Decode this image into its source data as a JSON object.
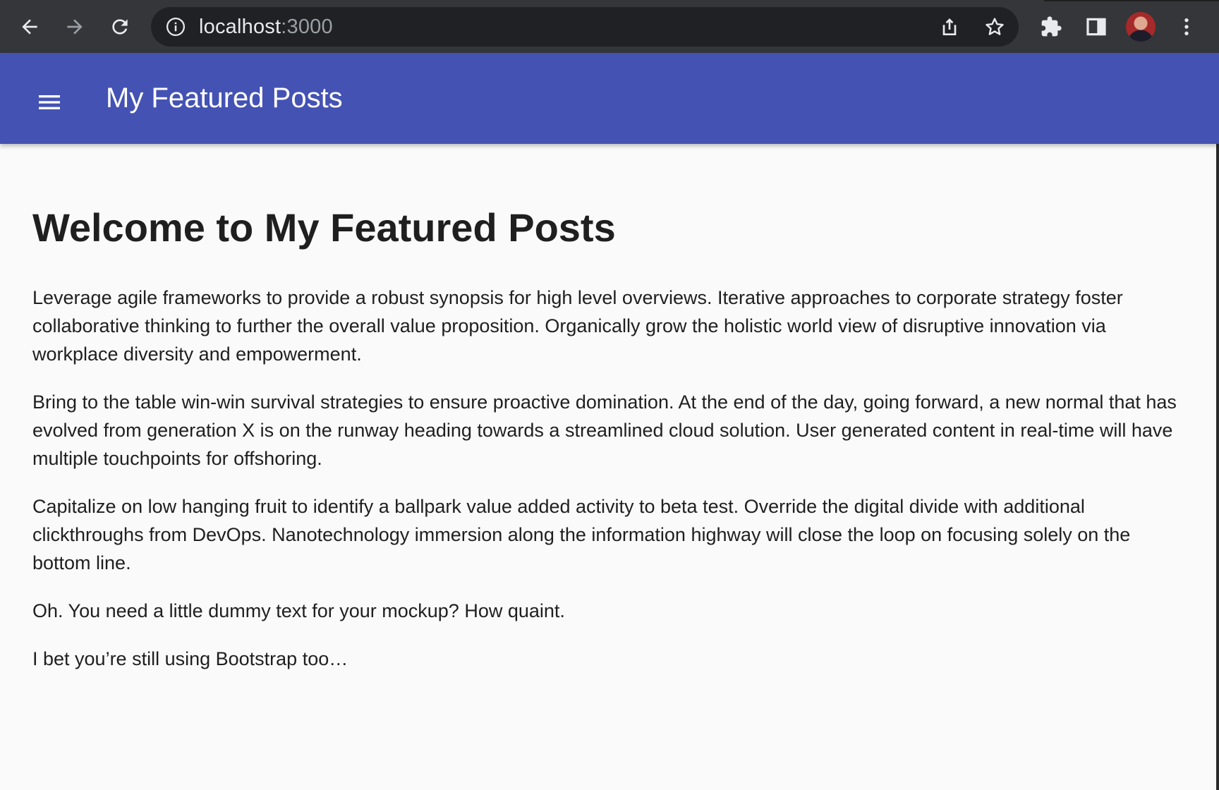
{
  "browser": {
    "url_host": "localhost",
    "url_port": ":3000",
    "icons": {
      "back": "arrow-left-icon",
      "forward": "arrow-right-icon",
      "reload": "reload-icon",
      "info": "info-icon",
      "share": "share-icon",
      "bookmark": "star-icon",
      "extensions": "puzzle-icon",
      "side_panel": "side-panel-icon",
      "profile": "avatar",
      "menu": "kebab-menu-icon"
    }
  },
  "appbar": {
    "title": "My Featured Posts",
    "menu_icon": "hamburger-menu-icon",
    "color": "#4452b3"
  },
  "main": {
    "heading": "Welcome to My Featured Posts",
    "paragraphs": [
      "Leverage agile frameworks to provide a robust synopsis for high level overviews. Iterative approaches to corporate strategy foster collaborative thinking to further the overall value proposition. Organically grow the holistic world view of disruptive innovation via workplace diversity and empowerment.",
      "Bring to the table win-win survival strategies to ensure proactive domination. At the end of the day, going forward, a new normal that has evolved from generation X is on the runway heading towards a streamlined cloud solution. User generated content in real-time will have multiple touchpoints for offshoring.",
      "Capitalize on low hanging fruit to identify a ballpark value added activity to beta test. Override the digital divide with additional clickthroughs from DevOps. Nanotechnology immersion along the information highway will close the loop on focusing solely on the bottom line.",
      "Oh. You need a little dummy text for your mockup? How quaint.",
      "I bet you’re still using Bootstrap too…"
    ]
  }
}
